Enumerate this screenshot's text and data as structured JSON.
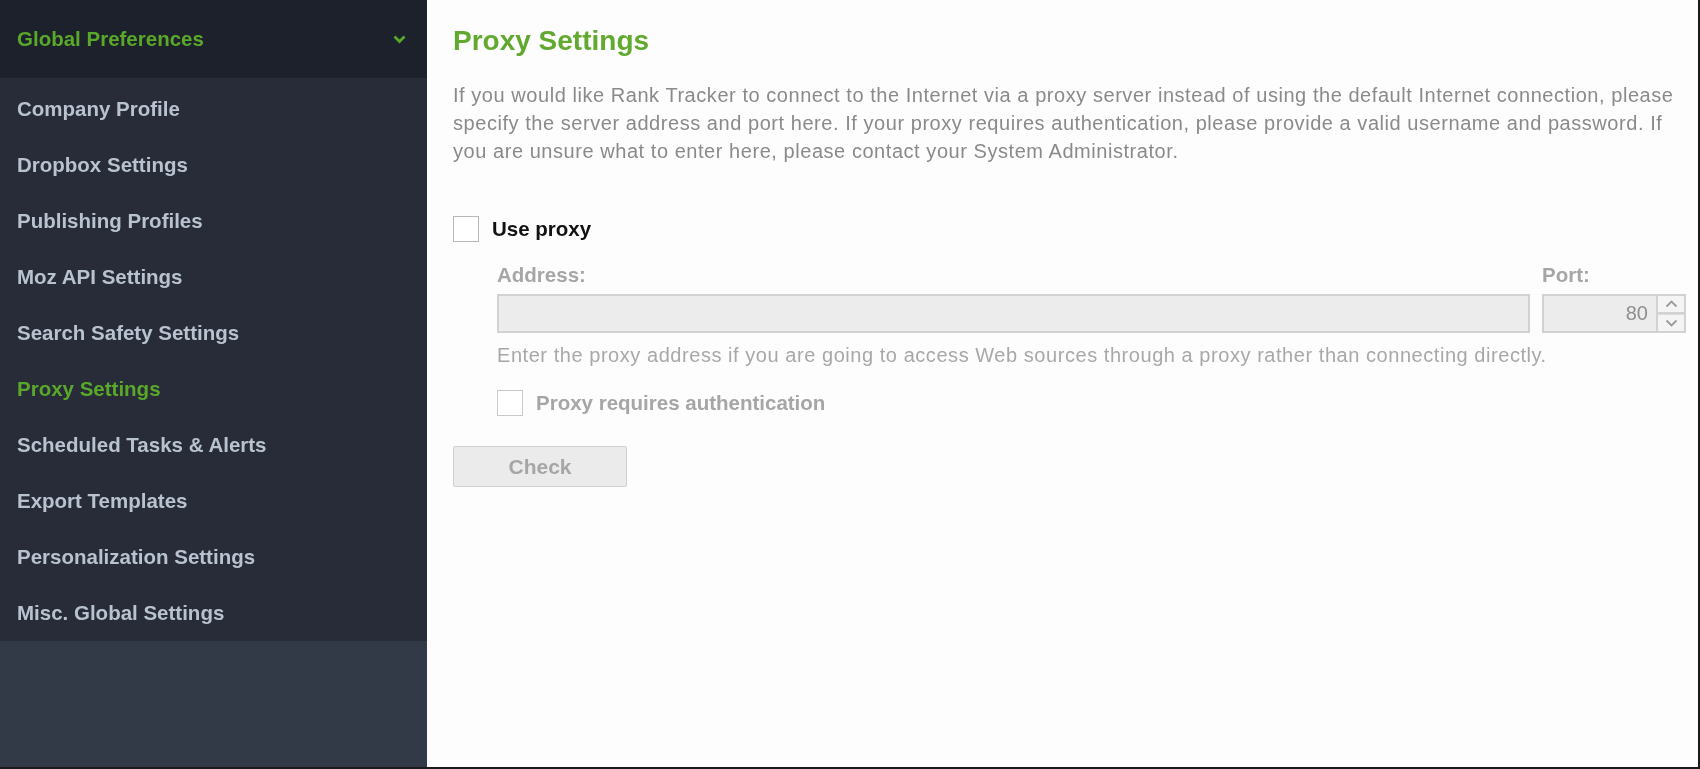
{
  "sidebar": {
    "header": {
      "label": "Global Preferences",
      "expanded": true
    },
    "items": [
      {
        "label": "Company Profile",
        "selected": false
      },
      {
        "label": "Dropbox Settings",
        "selected": false
      },
      {
        "label": "Publishing Profiles",
        "selected": false
      },
      {
        "label": "Moz API Settings",
        "selected": false
      },
      {
        "label": "Search Safety Settings",
        "selected": false
      },
      {
        "label": "Proxy Settings",
        "selected": true
      },
      {
        "label": "Scheduled Tasks & Alerts",
        "selected": false
      },
      {
        "label": "Export Templates",
        "selected": false
      },
      {
        "label": "Personalization Settings",
        "selected": false
      },
      {
        "label": "Misc. Global Settings",
        "selected": false
      }
    ]
  },
  "panel": {
    "title": "Proxy Settings",
    "description": "If you would like Rank Tracker to connect to the Internet via a proxy server instead of using the default Internet connection, please specify the server address and port here. If your proxy requires authentication, please provide a valid username and password. If you are unsure what to enter here, please contact your System Administrator.",
    "use_proxy": {
      "label": "Use proxy",
      "checked": false
    },
    "address": {
      "label": "Address:",
      "disabled": true
    },
    "port": {
      "label": "Port:",
      "value": "80",
      "disabled": true
    },
    "hint": "Enter the proxy address if you are going to access Web sources through a proxy rather than connecting directly.",
    "authentication": {
      "label": "Proxy requires authentication",
      "checked": false,
      "disabled": true
    },
    "check_button": {
      "label": "Check",
      "disabled": true
    }
  }
}
